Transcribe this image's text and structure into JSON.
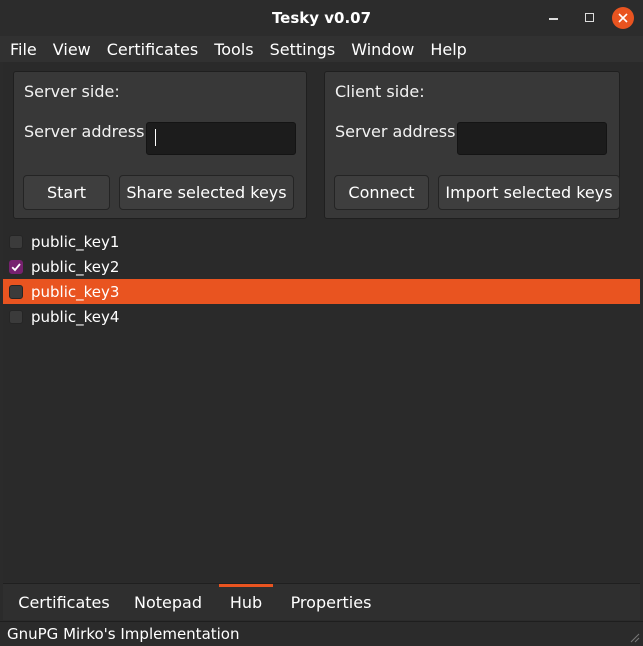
{
  "window": {
    "title": "Tesky v0.07"
  },
  "menu": [
    "File",
    "View",
    "Certificates",
    "Tools",
    "Settings",
    "Window",
    "Help"
  ],
  "server": {
    "heading": "Server side:",
    "address_label": "Server address:",
    "address_value": "",
    "start_label": "Start",
    "share_label": "Share selected keys"
  },
  "client": {
    "heading": "Client side:",
    "address_label": "Server address:",
    "address_value": "",
    "connect_label": "Connect",
    "import_label": "Import selected keys"
  },
  "keys": [
    {
      "label": "public_key1",
      "checked": false,
      "selected": false
    },
    {
      "label": "public_key2",
      "checked": true,
      "selected": false
    },
    {
      "label": "public_key3",
      "checked": false,
      "selected": true
    },
    {
      "label": "public_key4",
      "checked": false,
      "selected": false
    }
  ],
  "tabs": [
    {
      "label": "Certificates",
      "active": false
    },
    {
      "label": "Notepad",
      "active": false
    },
    {
      "label": "Hub",
      "active": true
    },
    {
      "label": "Properties",
      "active": false
    }
  ],
  "status": {
    "text": "GnuPG Mirko's Implementation"
  },
  "colors": {
    "accent": "#e95420",
    "checkbox_checked": "#77216f"
  }
}
